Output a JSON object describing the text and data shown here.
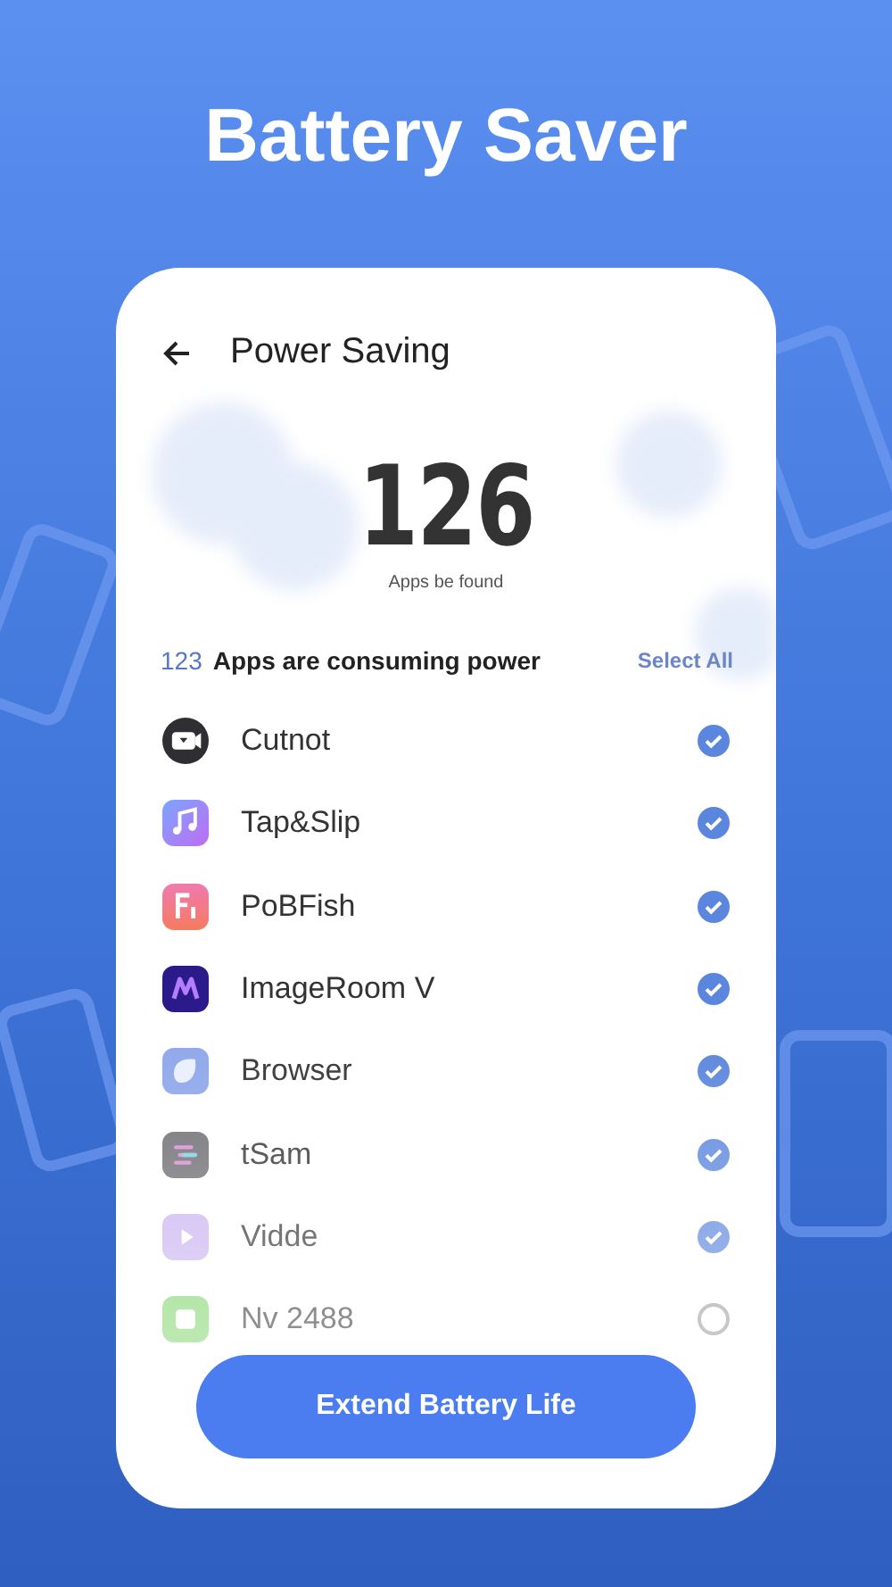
{
  "headline": "Battery Saver",
  "header": {
    "title": "Power Saving"
  },
  "summary": {
    "count": "126",
    "caption": "Apps be found"
  },
  "list_header": {
    "count": "123",
    "label": "Apps are consuming power",
    "action": "Select All"
  },
  "apps": [
    {
      "name": "Cutnot",
      "kind": "video",
      "checked": true
    },
    {
      "name": "Tap&Slip",
      "kind": "music",
      "checked": true
    },
    {
      "name": "PoBFish",
      "kind": "letter",
      "checked": true
    },
    {
      "name": "ImageRoom V",
      "kind": "wave",
      "checked": true
    },
    {
      "name": "Browser",
      "kind": "leaf",
      "checked": true
    },
    {
      "name": "tSam",
      "kind": "bars",
      "checked": true
    },
    {
      "name": "Vidde",
      "kind": "play",
      "checked": true
    },
    {
      "name": "Nv 2488",
      "kind": "frame",
      "checked": false
    }
  ],
  "button": {
    "label": "Extend Battery Life"
  }
}
